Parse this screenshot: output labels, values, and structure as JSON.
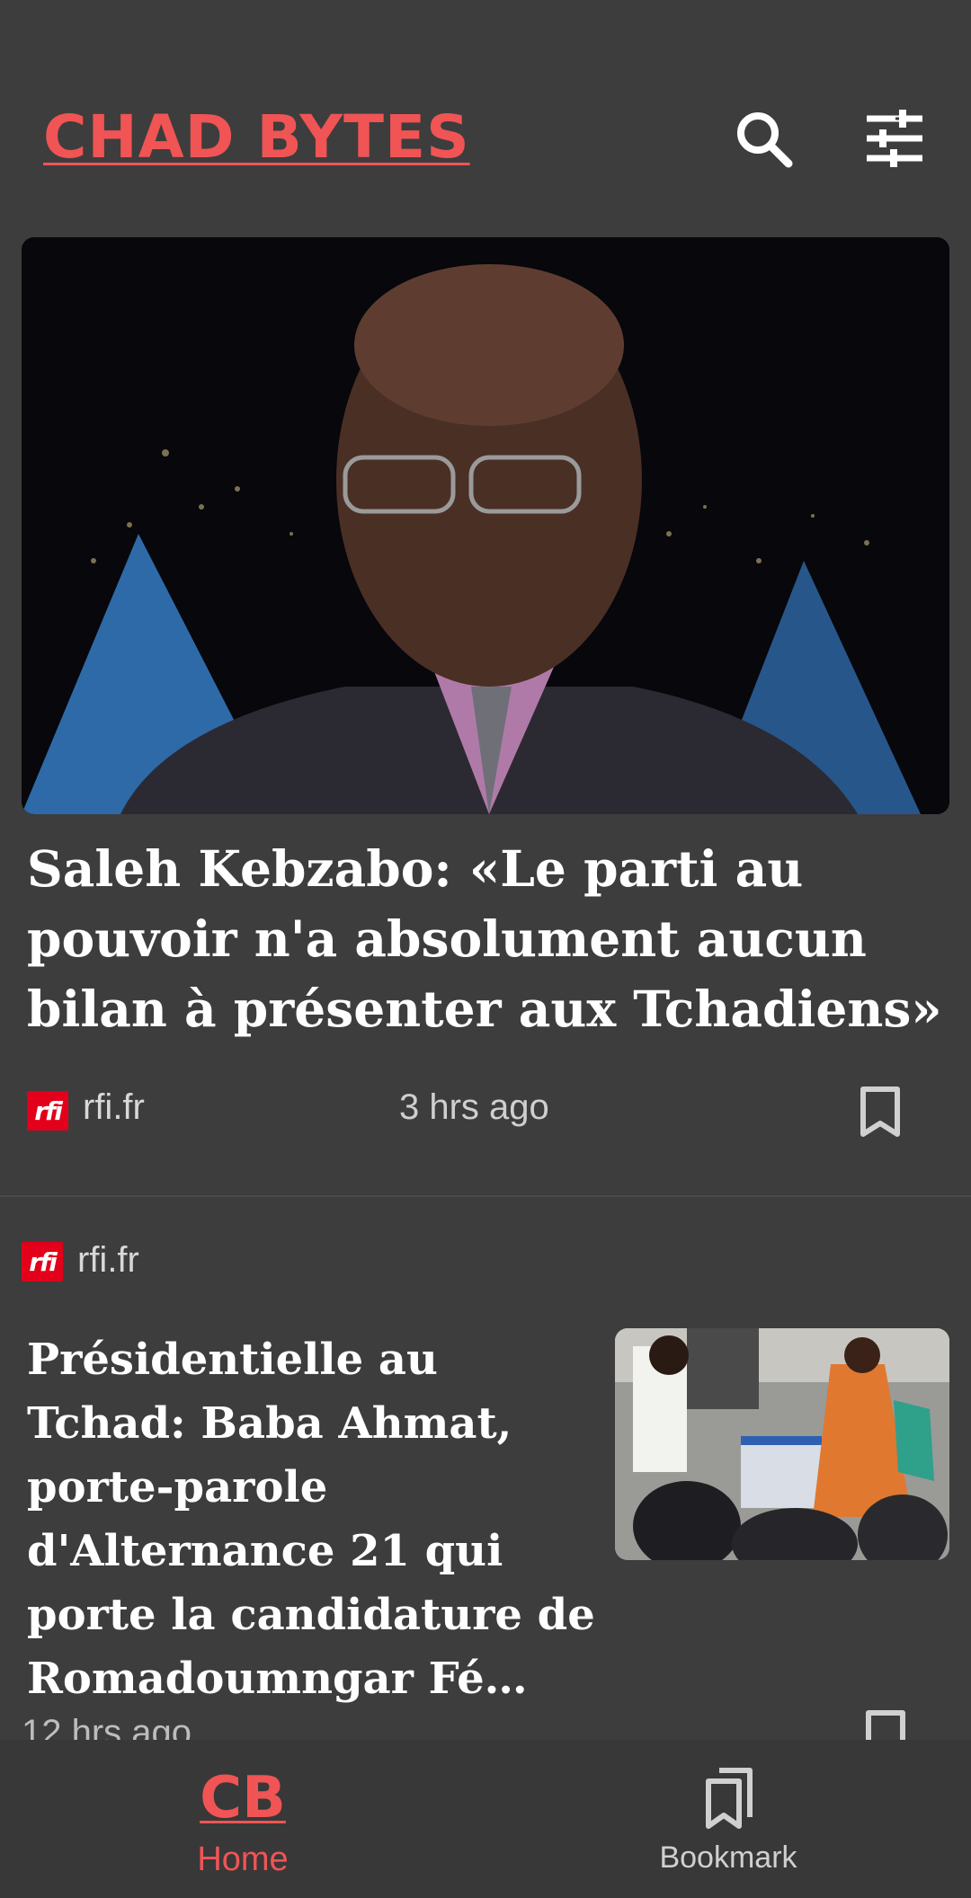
{
  "header": {
    "app_title": "CHAD BYTES",
    "search_icon": "search-icon",
    "filter_icon": "sliders-icon"
  },
  "articles": [
    {
      "headline": "Saleh Kebzabo: «Le parti au pouvoir n'a absolument aucun bilan à présenter aux Tchadiens»",
      "source": "rfi.fr",
      "source_logo_text": "rfi",
      "time": "3 hrs ago"
    },
    {
      "headline": "Présidentielle au Tchad: Baba Ahmat, porte-parole d'Alternance 21 qui porte la candidature de Romadoumngar Fé…",
      "source": "rfi.fr",
      "source_logo_text": "rfi",
      "time": "12 hrs ago"
    }
  ],
  "bottom_nav": {
    "home_logo": "CB",
    "home_label": "Home",
    "bookmark_label": "Bookmark"
  },
  "colors": {
    "accent": "#f05454",
    "background": "#3d3d3d",
    "nav_background": "#383838"
  }
}
